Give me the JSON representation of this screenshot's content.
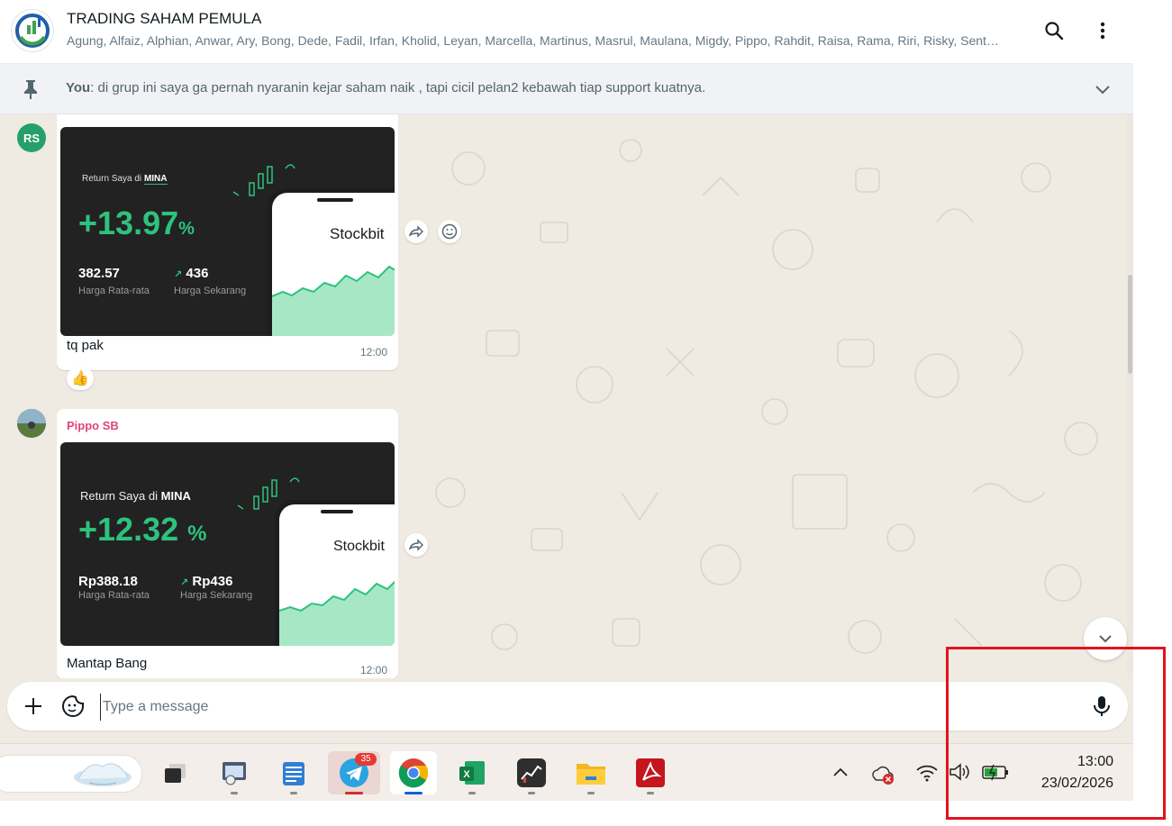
{
  "header": {
    "title": "TRADING SAHAM PEMULA",
    "members": "Agung, Alfaiz, Alphian, Anwar, Ary, Bong, Dede, Fadil, Irfan, Kholid, Leyan, Marcella, Martinus, Masrul, Maulana, Migdy, Pippo, Rahdit, Raisa, Rama, Riri, Risky, Sent…"
  },
  "pinned": {
    "author": "You",
    "text": ": di grup ini saya ga pernah nyaranin kejar saham naik , tapi cicil pelan2 kebawah tiap support kuatnya."
  },
  "messages": [
    {
      "avatar_initials": "RS",
      "avatar_color": "#25a06a",
      "card": {
        "label_prefix": "Return Saya di",
        "ticker": "MINA",
        "percent": "+13.97",
        "percent_sign": "%",
        "avg_price": "382.57",
        "avg_label": "Harga Rata-rata",
        "cur_price": "436",
        "cur_label": "Harga Sekarang",
        "brand": "Stockbit"
      },
      "text": "tq pak",
      "time": "12:00",
      "reaction": "👍"
    },
    {
      "sender": "Pippo SB",
      "sender_color": "#e0457b",
      "card": {
        "label_prefix": "Return Saya di",
        "ticker": "MINA",
        "percent": "+12.32",
        "percent_sign": "%",
        "avg_price": "Rp388.18",
        "avg_label": "Harga Rata-rata",
        "cur_price": "Rp436",
        "cur_label": "Harga Sekarang",
        "brand": "Stockbit"
      },
      "text": "Mantap Bang",
      "time": "12:00"
    }
  ],
  "composer": {
    "placeholder": "Type a message"
  },
  "taskbar": {
    "telegram_badge": "35",
    "clock_time": "13:00",
    "clock_date": "23/02/2026"
  },
  "colors": {
    "accent_green": "#25d366",
    "card_green": "#2ec27e",
    "highlight_red": "#e0141c"
  }
}
